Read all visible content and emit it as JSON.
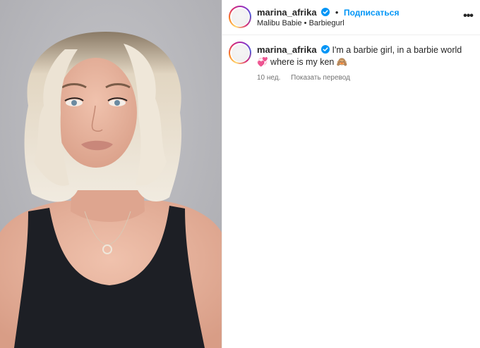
{
  "post": {
    "media_alt": "photo-of-woman-with-platinum-bob",
    "media_colors": {
      "background": "#b5b5b9",
      "hair": "#e8dcc6",
      "top": "#1c1e24",
      "skin": "#e6b49f"
    }
  },
  "header": {
    "username": "marina_afrika",
    "separator": "•",
    "follow_label": "Подписаться",
    "subtitle_left": "Malibu Babie",
    "subtitle_sep": "•",
    "subtitle_right": "Barbiegurl",
    "more_label": "•••"
  },
  "comment": {
    "username": "marina_afrika",
    "text": "I'm a barbie girl, in a barbie world 💞 where is my ken 🙈",
    "time": "10 нед.",
    "translate_label": "Показать перевод"
  },
  "colors": {
    "link": "#0095f6",
    "verified": "#0095f6",
    "muted": "#737373",
    "text": "#262626"
  },
  "icons": {
    "verified": "verified-badge-icon",
    "more": "more-options-icon"
  }
}
